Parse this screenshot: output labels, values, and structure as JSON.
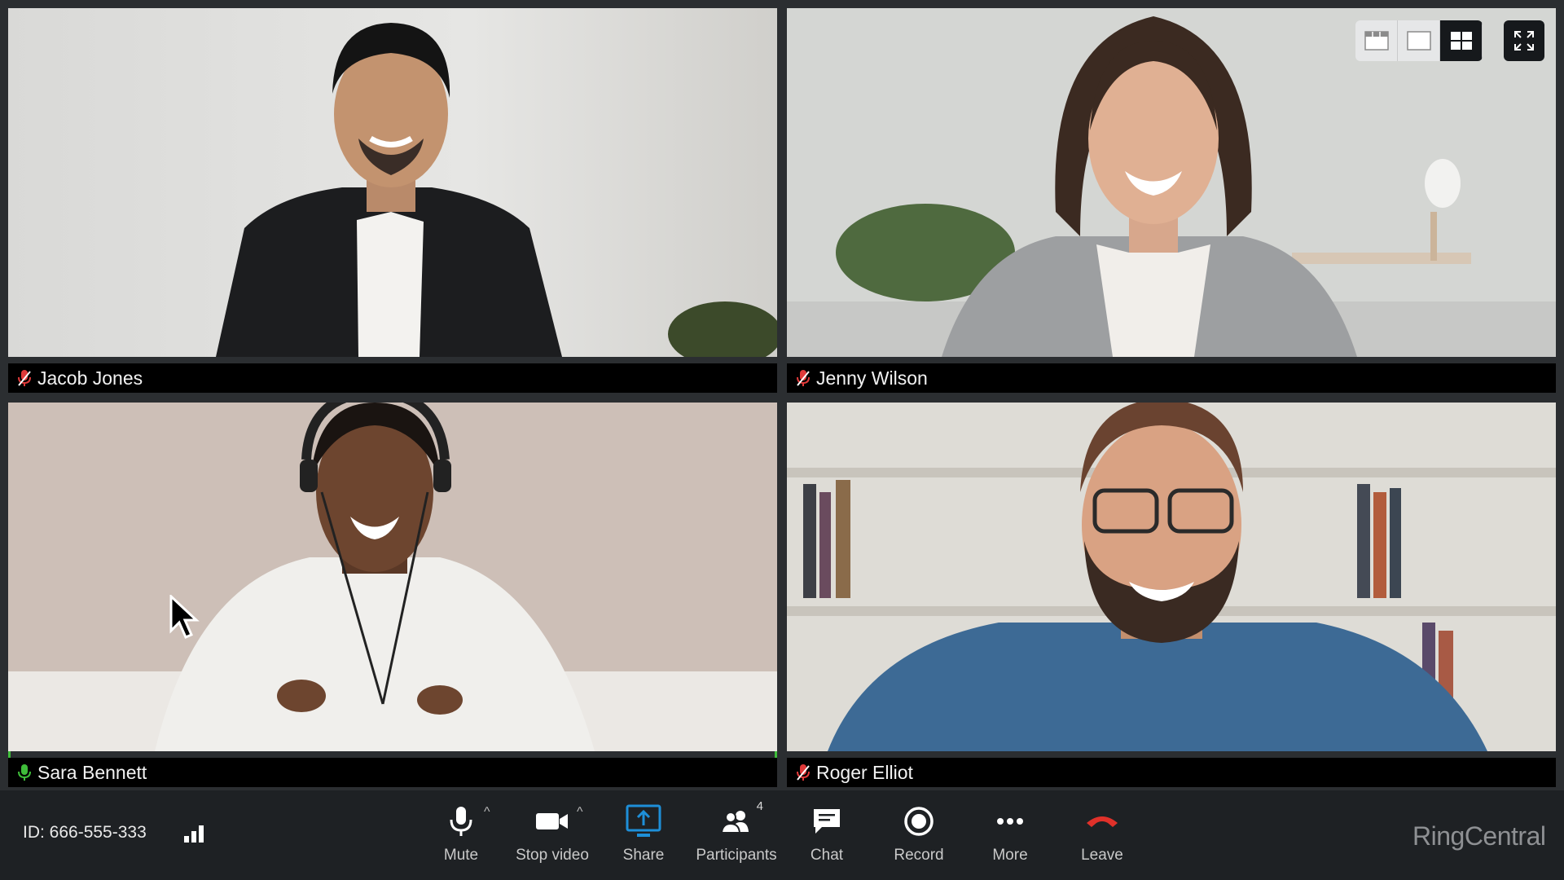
{
  "participants": [
    {
      "name": "Jacob Jones",
      "mic": "muted"
    },
    {
      "name": "Jenny Wilson",
      "mic": "muted"
    },
    {
      "name": "Sara Bennett",
      "mic": "active"
    },
    {
      "name": "Roger Elliot",
      "mic": "muted"
    }
  ],
  "view_controls": {
    "options": [
      "filmstrip-view-icon",
      "speaker-view-icon",
      "gallery-view-icon"
    ],
    "selected": "gallery-view-icon",
    "fullscreen_icon": "fullscreen-icon"
  },
  "meeting": {
    "id_label": "ID: 666-555-333"
  },
  "toolbar": {
    "mute": "Mute",
    "stop_video": "Stop video",
    "share": "Share",
    "participants": "Participants",
    "participants_count": "4",
    "chat": "Chat",
    "record": "Record",
    "more": "More",
    "leave": "Leave"
  },
  "brand": {
    "name": "RingCentral"
  },
  "colors": {
    "active_speaker": "#3fbd3a",
    "muted_mic": "#e03a3a",
    "share_accent": "#1e8fd8",
    "leave": "#e0312a",
    "toolbar_bg": "#1e2124"
  }
}
